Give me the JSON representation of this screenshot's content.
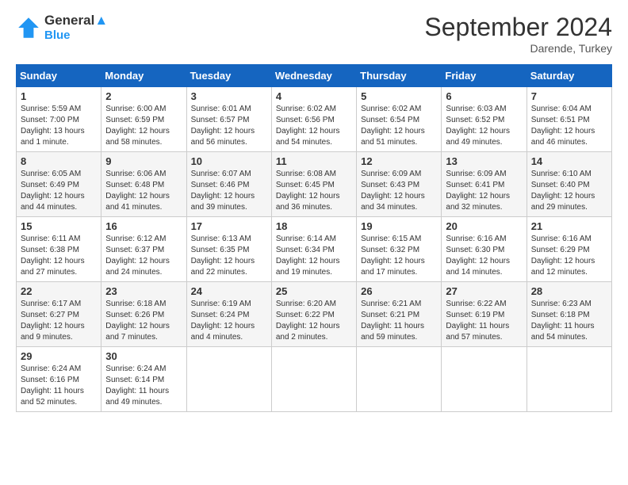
{
  "header": {
    "logo_line1": "General",
    "logo_line2": "Blue",
    "month": "September 2024",
    "location": "Darende, Turkey"
  },
  "days_of_week": [
    "Sunday",
    "Monday",
    "Tuesday",
    "Wednesday",
    "Thursday",
    "Friday",
    "Saturday"
  ],
  "weeks": [
    [
      {
        "day": 1,
        "info": "Sunrise: 5:59 AM\nSunset: 7:00 PM\nDaylight: 13 hours\nand 1 minute."
      },
      {
        "day": 2,
        "info": "Sunrise: 6:00 AM\nSunset: 6:59 PM\nDaylight: 12 hours\nand 58 minutes."
      },
      {
        "day": 3,
        "info": "Sunrise: 6:01 AM\nSunset: 6:57 PM\nDaylight: 12 hours\nand 56 minutes."
      },
      {
        "day": 4,
        "info": "Sunrise: 6:02 AM\nSunset: 6:56 PM\nDaylight: 12 hours\nand 54 minutes."
      },
      {
        "day": 5,
        "info": "Sunrise: 6:02 AM\nSunset: 6:54 PM\nDaylight: 12 hours\nand 51 minutes."
      },
      {
        "day": 6,
        "info": "Sunrise: 6:03 AM\nSunset: 6:52 PM\nDaylight: 12 hours\nand 49 minutes."
      },
      {
        "day": 7,
        "info": "Sunrise: 6:04 AM\nSunset: 6:51 PM\nDaylight: 12 hours\nand 46 minutes."
      }
    ],
    [
      {
        "day": 8,
        "info": "Sunrise: 6:05 AM\nSunset: 6:49 PM\nDaylight: 12 hours\nand 44 minutes."
      },
      {
        "day": 9,
        "info": "Sunrise: 6:06 AM\nSunset: 6:48 PM\nDaylight: 12 hours\nand 41 minutes."
      },
      {
        "day": 10,
        "info": "Sunrise: 6:07 AM\nSunset: 6:46 PM\nDaylight: 12 hours\nand 39 minutes."
      },
      {
        "day": 11,
        "info": "Sunrise: 6:08 AM\nSunset: 6:45 PM\nDaylight: 12 hours\nand 36 minutes."
      },
      {
        "day": 12,
        "info": "Sunrise: 6:09 AM\nSunset: 6:43 PM\nDaylight: 12 hours\nand 34 minutes."
      },
      {
        "day": 13,
        "info": "Sunrise: 6:09 AM\nSunset: 6:41 PM\nDaylight: 12 hours\nand 32 minutes."
      },
      {
        "day": 14,
        "info": "Sunrise: 6:10 AM\nSunset: 6:40 PM\nDaylight: 12 hours\nand 29 minutes."
      }
    ],
    [
      {
        "day": 15,
        "info": "Sunrise: 6:11 AM\nSunset: 6:38 PM\nDaylight: 12 hours\nand 27 minutes."
      },
      {
        "day": 16,
        "info": "Sunrise: 6:12 AM\nSunset: 6:37 PM\nDaylight: 12 hours\nand 24 minutes."
      },
      {
        "day": 17,
        "info": "Sunrise: 6:13 AM\nSunset: 6:35 PM\nDaylight: 12 hours\nand 22 minutes."
      },
      {
        "day": 18,
        "info": "Sunrise: 6:14 AM\nSunset: 6:34 PM\nDaylight: 12 hours\nand 19 minutes."
      },
      {
        "day": 19,
        "info": "Sunrise: 6:15 AM\nSunset: 6:32 PM\nDaylight: 12 hours\nand 17 minutes."
      },
      {
        "day": 20,
        "info": "Sunrise: 6:16 AM\nSunset: 6:30 PM\nDaylight: 12 hours\nand 14 minutes."
      },
      {
        "day": 21,
        "info": "Sunrise: 6:16 AM\nSunset: 6:29 PM\nDaylight: 12 hours\nand 12 minutes."
      }
    ],
    [
      {
        "day": 22,
        "info": "Sunrise: 6:17 AM\nSunset: 6:27 PM\nDaylight: 12 hours\nand 9 minutes."
      },
      {
        "day": 23,
        "info": "Sunrise: 6:18 AM\nSunset: 6:26 PM\nDaylight: 12 hours\nand 7 minutes."
      },
      {
        "day": 24,
        "info": "Sunrise: 6:19 AM\nSunset: 6:24 PM\nDaylight: 12 hours\nand 4 minutes."
      },
      {
        "day": 25,
        "info": "Sunrise: 6:20 AM\nSunset: 6:22 PM\nDaylight: 12 hours\nand 2 minutes."
      },
      {
        "day": 26,
        "info": "Sunrise: 6:21 AM\nSunset: 6:21 PM\nDaylight: 11 hours\nand 59 minutes."
      },
      {
        "day": 27,
        "info": "Sunrise: 6:22 AM\nSunset: 6:19 PM\nDaylight: 11 hours\nand 57 minutes."
      },
      {
        "day": 28,
        "info": "Sunrise: 6:23 AM\nSunset: 6:18 PM\nDaylight: 11 hours\nand 54 minutes."
      }
    ],
    [
      {
        "day": 29,
        "info": "Sunrise: 6:24 AM\nSunset: 6:16 PM\nDaylight: 11 hours\nand 52 minutes."
      },
      {
        "day": 30,
        "info": "Sunrise: 6:24 AM\nSunset: 6:14 PM\nDaylight: 11 hours\nand 49 minutes."
      },
      null,
      null,
      null,
      null,
      null
    ]
  ]
}
